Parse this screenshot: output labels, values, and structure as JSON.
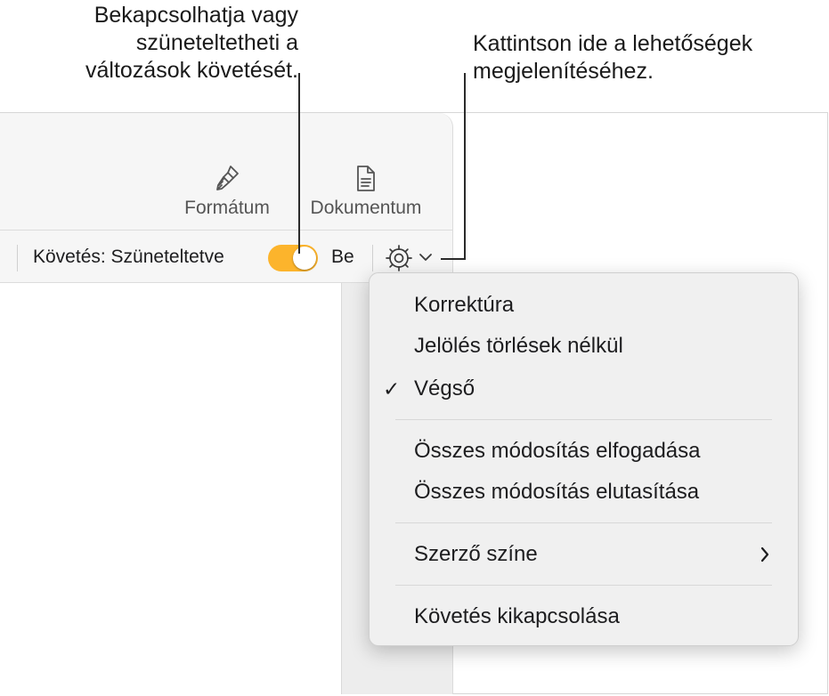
{
  "callouts": {
    "left": "Bekapcsolhatja vagy\nszüneteltetheti a\nváltozások követését.",
    "right": "Kattintson ide a lehetőségek\nmegjelenítéséhez."
  },
  "toolbar": {
    "format_label": "Formátum",
    "document_label": "Dokumentum",
    "format_icon": "paintbrush-icon",
    "document_icon": "document-icon"
  },
  "tracking": {
    "status_label": "Követés: Szüneteltetve",
    "toggle_on": true,
    "toggle_label": "Be",
    "options_icon": "gear-icon",
    "toggle_color": "#fcb42c"
  },
  "menu": {
    "markup": "Korrektúra",
    "markup_no_deletions": "Jelölés törlések nélkül",
    "final": "Végső",
    "final_checked": true,
    "accept_all": "Összes módosítás elfogadása",
    "reject_all": "Összes módosítás elutasítása",
    "author_color": "Szerző színe",
    "turn_off_tracking": "Követés kikapcsolása"
  }
}
